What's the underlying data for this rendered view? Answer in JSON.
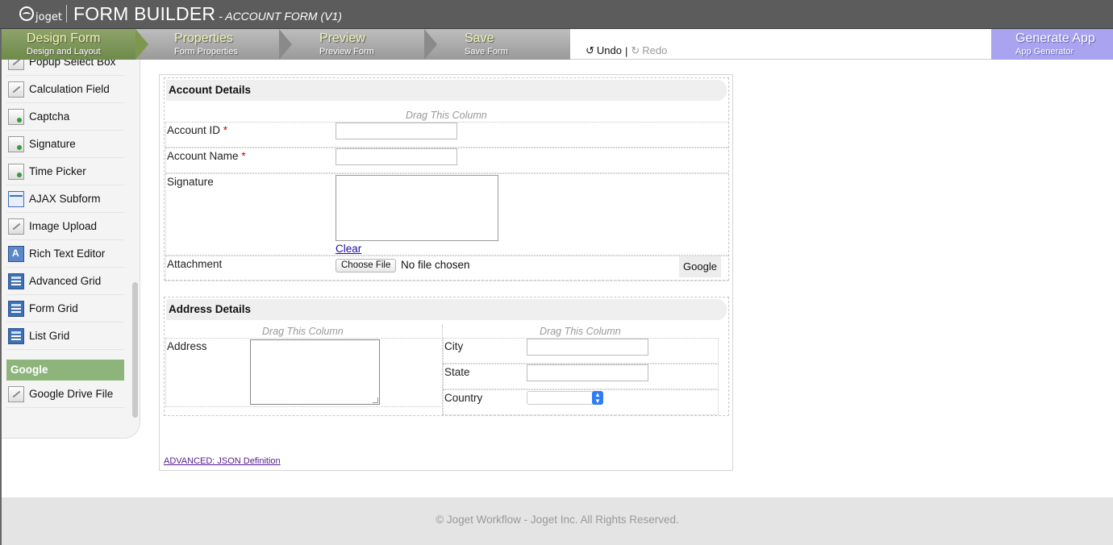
{
  "header": {
    "logo_text": "joget",
    "title": "FORM BUILDER",
    "subtitle": "- ACCOUNT FORM (V1)"
  },
  "steps": {
    "design": {
      "title": "Design Form",
      "subtitle": "Design and Layout"
    },
    "properties": {
      "title": "Properties",
      "subtitle": "Form Properties"
    },
    "preview": {
      "title": "Preview",
      "subtitle": "Preview Form"
    },
    "save": {
      "title": "Save",
      "subtitle": "Save Form"
    },
    "undo_label": "Undo",
    "separator": "|",
    "redo_label": "Redo",
    "generate": {
      "title": "Generate App",
      "subtitle": "App Generator"
    }
  },
  "palette": {
    "items": [
      {
        "label": "Popup Select Box",
        "icon": "pencil-icon"
      },
      {
        "label": "Calculation Field",
        "icon": "pencil-icon"
      },
      {
        "label": "Captcha",
        "icon": "plugin-icon"
      },
      {
        "label": "Signature",
        "icon": "plugin-icon"
      },
      {
        "label": "Time Picker",
        "icon": "plugin-icon"
      },
      {
        "label": "AJAX Subform",
        "icon": "form-icon"
      },
      {
        "label": "Image Upload",
        "icon": "pencil-icon"
      },
      {
        "label": "Rich Text Editor",
        "icon": "rich-text-icon"
      },
      {
        "label": "Advanced Grid",
        "icon": "grid-icon"
      },
      {
        "label": "Form Grid",
        "icon": "grid-icon"
      },
      {
        "label": "List Grid",
        "icon": "grid-icon"
      }
    ],
    "group_label": "Google",
    "group_items": [
      {
        "label": "Google Drive File",
        "icon": "pencil-icon"
      }
    ]
  },
  "form": {
    "account_section": {
      "title": "Account Details",
      "drag_label": "Drag This Column",
      "account_id_label": "Account ID",
      "account_name_label": "Account Name",
      "required_mark": "*",
      "signature_label": "Signature",
      "clear_label": "Clear",
      "attachment_label": "Attachment",
      "choose_file_label": "Choose File",
      "no_file_text": "No file chosen",
      "google_button": "Google"
    },
    "address_section": {
      "title": "Address Details",
      "drag_label_left": "Drag This Column",
      "drag_label_right": "Drag This Column",
      "address_label": "Address",
      "city_label": "City",
      "state_label": "State",
      "country_label": "Country"
    },
    "json_link": "ADVANCED: JSON Definition"
  },
  "footer": {
    "text": "© Joget Workflow - Joget Inc. All Rights Reserved."
  },
  "colors": {
    "active_step": "#7e974f",
    "generate_button": "#a9a3f0",
    "palette_group": "#8db57b",
    "required": "#cc0000",
    "select_arrow": "#2e7cf6"
  }
}
